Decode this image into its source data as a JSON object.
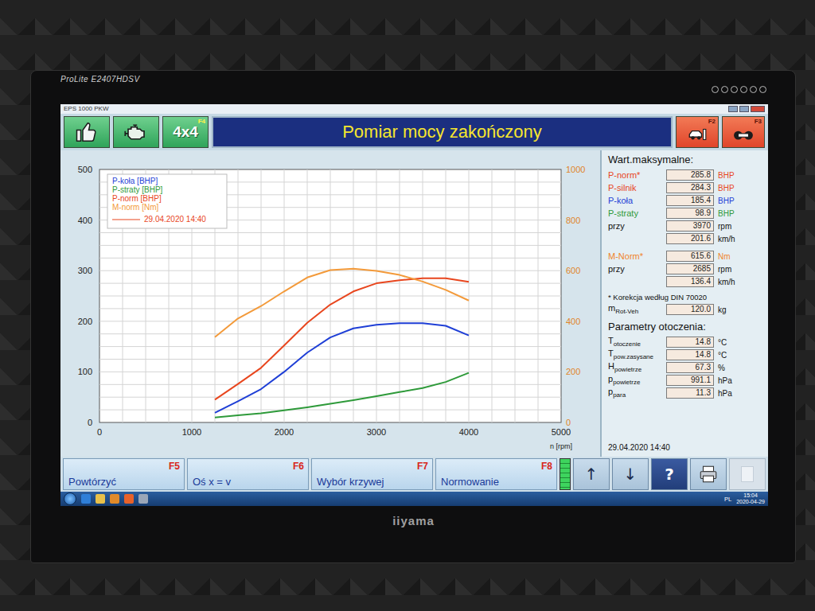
{
  "monitor": {
    "model": "ProLite E2407HDSV",
    "brand": "iiyama",
    "bezel_buttons": 6
  },
  "window": {
    "title": "EPS 1000 PKW",
    "controls": [
      "minimize",
      "maximize",
      "close"
    ]
  },
  "toolbar": {
    "left": [
      {
        "kind": "thumb"
      },
      {
        "kind": "engine"
      },
      {
        "kind": "text",
        "label": "4x4",
        "key": "F4"
      }
    ],
    "title": "Pomiar mocy zakończony",
    "right": [
      {
        "kind": "car",
        "key": "F2"
      },
      {
        "kind": "rollers",
        "key": "F3"
      }
    ]
  },
  "chart": {
    "y_left_ticks": [
      "0",
      "100",
      "200",
      "300",
      "400",
      "500"
    ],
    "y_right_ticks": [
      "0",
      "200",
      "400",
      "600",
      "800",
      "1000"
    ],
    "x_ticks": [
      "0",
      "1000",
      "2000",
      "3000",
      "4000",
      "5000"
    ],
    "x_label": "n [rpm]",
    "rpm": [
      1250,
      1500,
      1750,
      2000,
      2250,
      2500,
      2750,
      3000,
      3250,
      3500,
      3750,
      4000
    ],
    "series": [
      {
        "name": "P-koła [BHP]",
        "axis": "left",
        "color": "#1f3fd6",
        "values": [
          19,
          42,
          66,
          100,
          138,
          168,
          186,
          193,
          196,
          196,
          191,
          172
        ]
      },
      {
        "name": "P-straty [BHP]",
        "axis": "left",
        "color": "#2e9a3a",
        "values": [
          10,
          14,
          18,
          24,
          30,
          37,
          44,
          52,
          60,
          68,
          80,
          98
        ]
      },
      {
        "name": "P-norm [BHP]",
        "axis": "left",
        "color": "#e8461e",
        "values": [
          45,
          76,
          108,
          152,
          197,
          233,
          259,
          275,
          281,
          285,
          285,
          278
        ]
      },
      {
        "name": "M-norm [Nm]",
        "axis": "right",
        "color": "#f39a3a",
        "values": [
          337,
          411,
          460,
          518,
          573,
          602,
          608,
          599,
          583,
          557,
          524,
          482
        ]
      }
    ],
    "legend_date": {
      "text": "29.04.2020 14:40",
      "color": "#e8461e"
    }
  },
  "max_values": {
    "title": "Wart.maksymalne:",
    "power": [
      {
        "label": "P-norm*",
        "value": "285.8",
        "unit": "BHP",
        "color": "#e8461e"
      },
      {
        "label": "P-silnik",
        "value": "284.3",
        "unit": "BHP",
        "color": "#e8461e"
      },
      {
        "label": "P-koła",
        "value": "185.4",
        "unit": "BHP",
        "color": "#1f3fd6"
      },
      {
        "label": "P-straty",
        "value": "98.9",
        "unit": "BHP",
        "color": "#2e9a3a"
      }
    ],
    "power_at": {
      "label": "przy",
      "rpm": {
        "value": "3970",
        "unit": "rpm"
      },
      "speed": {
        "value": "201.6",
        "unit": "km/h"
      }
    },
    "torque": {
      "label": "M-Norm*",
      "value": "615.6",
      "unit": "Nm",
      "color": "#f0842a"
    },
    "torque_at": {
      "label": "przy",
      "rpm": {
        "value": "2685",
        "unit": "rpm"
      },
      "speed": {
        "value": "136.4",
        "unit": "km/h"
      }
    },
    "note": "* Korekcja według DIN 70020",
    "mass": {
      "label": "m",
      "sub": "Rot-Veh",
      "value": "120.0",
      "unit": "kg"
    }
  },
  "ambient": {
    "title": "Parametry otoczenia:",
    "rows": [
      {
        "label": "T",
        "sub": "otoczenie",
        "value": "14.8",
        "unit": "°C"
      },
      {
        "label": "T",
        "sub": "pow.zasysane",
        "value": "14.8",
        "unit": "°C"
      },
      {
        "label": "H",
        "sub": "powietrze",
        "value": "67.3",
        "unit": "%"
      },
      {
        "label": "p",
        "sub": "powietrze",
        "value": "991.1",
        "unit": "hPa"
      },
      {
        "label": "p",
        "sub": "para",
        "value": "11.3",
        "unit": "hPa"
      }
    ]
  },
  "date": "29.04.2020 14:40",
  "function_keys": [
    {
      "key": "F5",
      "label": "Powtórzyć"
    },
    {
      "key": "F6",
      "label": "Oś x = v"
    },
    {
      "key": "F7",
      "label": "Wybór krzywej"
    },
    {
      "key": "F8",
      "label": "Normowanie"
    }
  ],
  "indicator": {
    "level": 1.0
  },
  "icon_buttons": [
    {
      "kind": "glyph",
      "glyph": "↑",
      "disabled": false
    },
    {
      "kind": "glyph",
      "glyph": "↓",
      "disabled": false
    },
    {
      "kind": "help",
      "glyph": "?",
      "disabled": false
    },
    {
      "kind": "printer",
      "disabled": false
    },
    {
      "kind": "blank",
      "disabled": true
    }
  ],
  "taskbar": {
    "icons": [
      "ie",
      "folder",
      "media",
      "firefox",
      "app"
    ],
    "lang": "PL",
    "time": "15:04",
    "date": "2020-04-29"
  }
}
